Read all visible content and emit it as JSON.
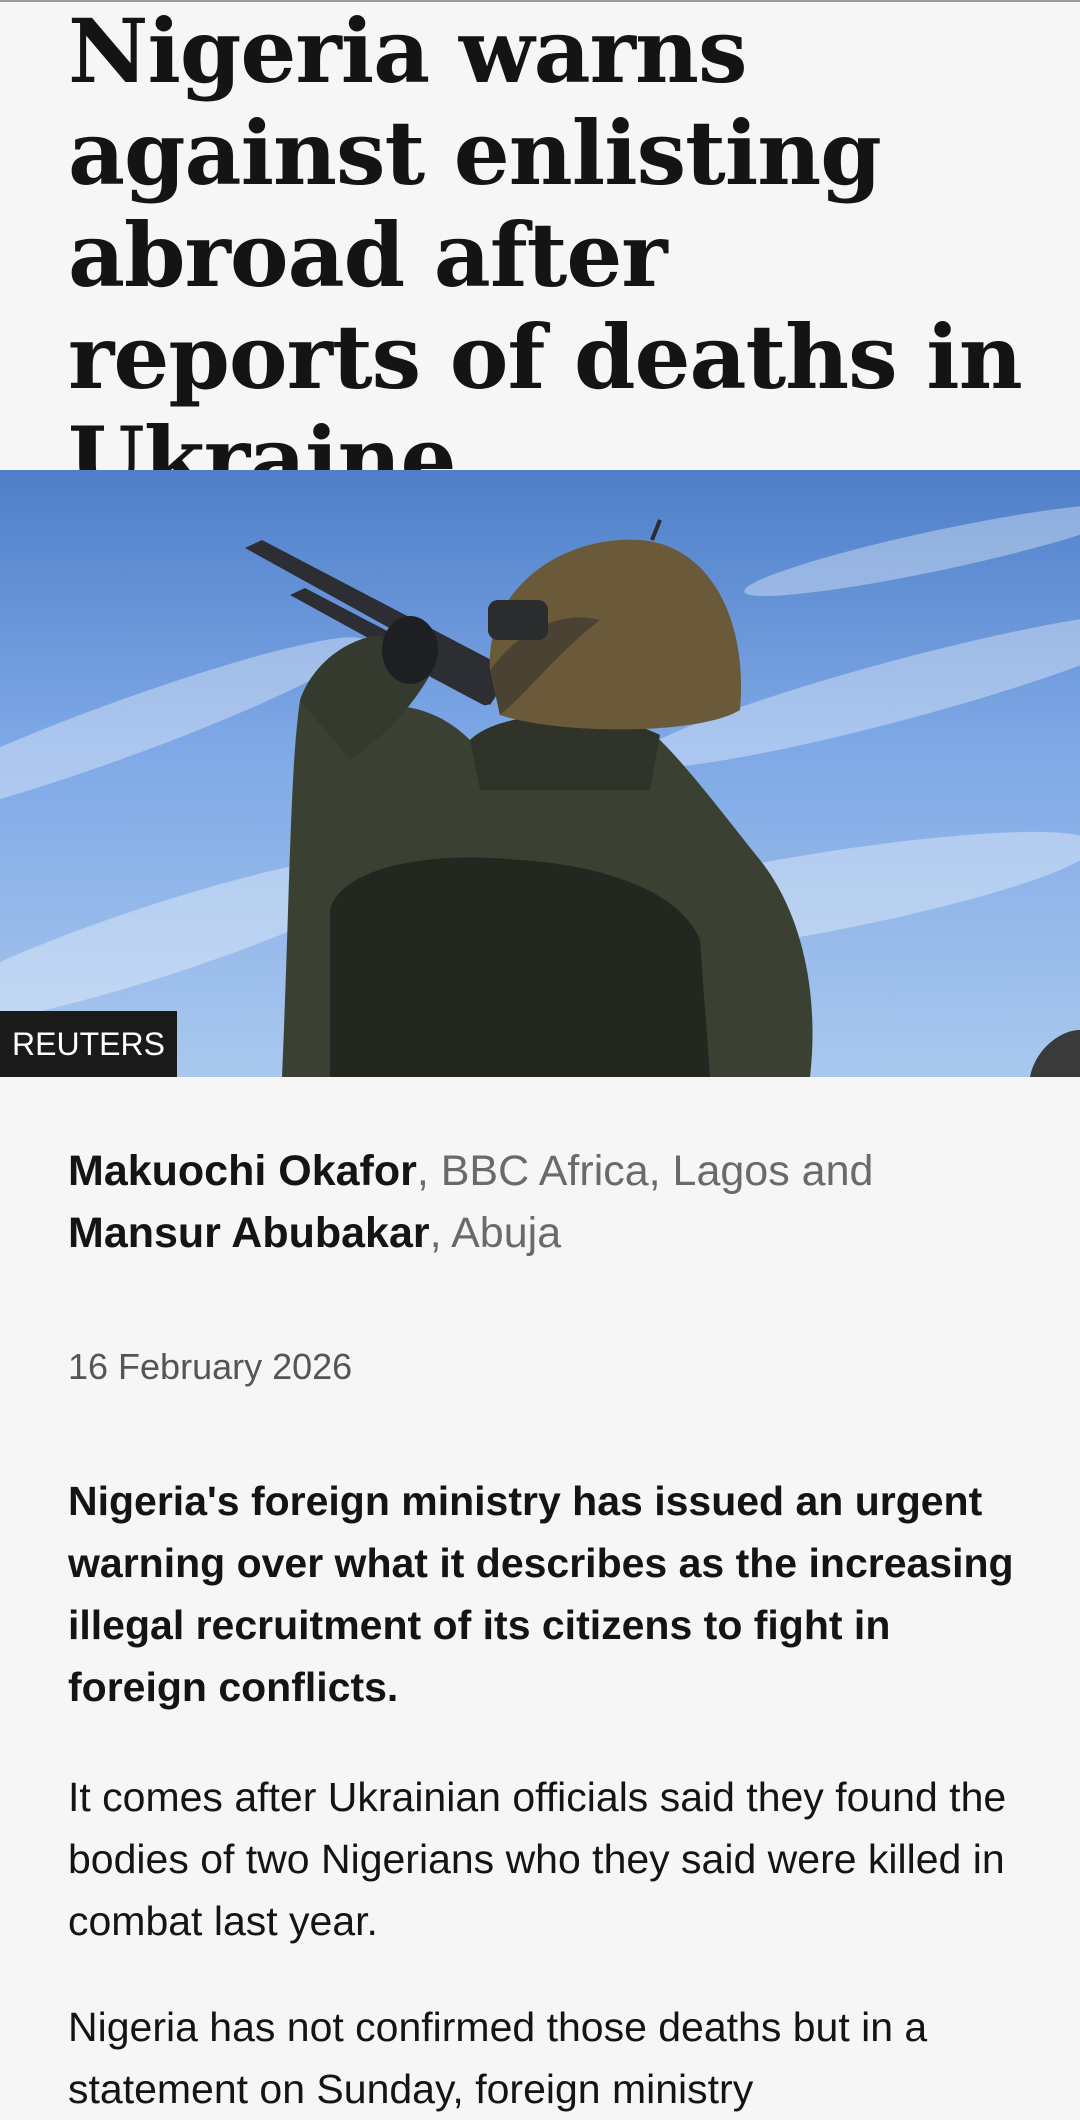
{
  "article": {
    "headline": "Nigeria warns against enlisting abroad after reports of deaths in Ukraine",
    "image": {
      "credit": "REUTERS",
      "subject": "soldier-with-rifle-against-sky"
    },
    "byline": {
      "author1": "Makuochi Okafor",
      "author1_affiliation": ", BBC Africa, Lagos and ",
      "author2": "Mansur Abubakar",
      "author2_affiliation": ", Abuja"
    },
    "date": "16 February 2026",
    "lead": "Nigeria's foreign ministry has issued an urgent warning over what it describes as the increasing illegal recruitment of its citizens to fight in foreign conflicts.",
    "paragraphs": [
      "It comes after Ukrainian officials said they found the bodies of two Nigerians who they said were killed in combat last year.",
      "Nigeria has not confirmed those deaths but in a statement on Sunday, foreign ministry"
    ]
  }
}
